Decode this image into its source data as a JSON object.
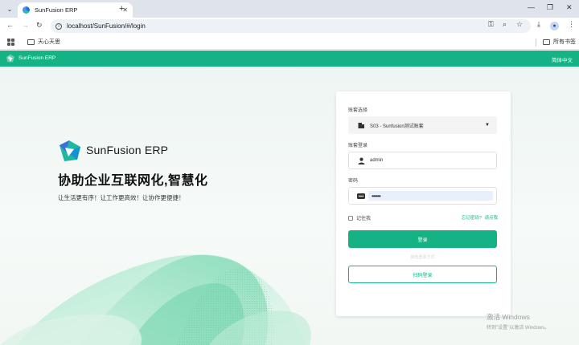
{
  "browser": {
    "tab_title": "SunFusion ERP",
    "tab_close": "✕",
    "new_tab": "+",
    "url": "localhost/SunFusion/#/login",
    "window_controls": [
      "—",
      "❐",
      "✕"
    ],
    "bookmarks": [
      {
        "label": "天心天思"
      }
    ],
    "all_bookmarks": "所有书签"
  },
  "app": {
    "brand_small": "SunFusion ERP",
    "language": "简体中文",
    "brand": "SunFusion ERP",
    "slogan": "协助企业互联网化,智慧化",
    "subslogan": "让生活更有序！让工作更高效！让协作更便捷！"
  },
  "login": {
    "account_set_label": "账套选择",
    "account_set_value": "S03 - Sunfusion测试账套",
    "username_label": "账套登录",
    "username_value": "admin",
    "password_label": "密码",
    "password_value": "••••••",
    "remember_label": "记住我",
    "forgot_label": "忘记密码?",
    "register_label": "请点我",
    "login_button": "登录",
    "other_methods": "其他登录方式",
    "scan_button": "扫码登录"
  },
  "watermark": {
    "line1": "激活 Windows",
    "line2": "转到\"设置\"以激活 Windows。"
  },
  "colors": {
    "brand_green": "#15b286",
    "chrome_tab_bar": "#dfe3eb"
  }
}
